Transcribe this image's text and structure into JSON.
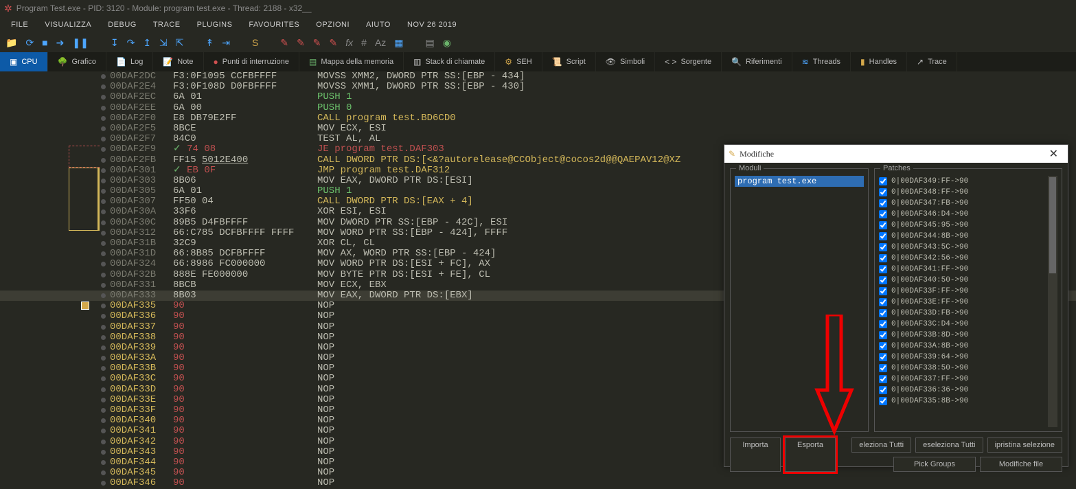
{
  "title": "Program Test.exe - PID: 3120 - Module: program test.exe - Thread: 2188 - x32__",
  "menu": [
    "FILE",
    "VISUALIZZA",
    "DEBUG",
    "TRACE",
    "PLUGINS",
    "FAVOURITES",
    "OPZIONI",
    "AIUTO",
    "NOV 26 2019"
  ],
  "tabs": [
    {
      "label": "CPU",
      "icon": "▣",
      "active": true,
      "color": "#5bb"
    },
    {
      "label": "Grafico",
      "icon": "🌳"
    },
    {
      "label": "Log",
      "icon": "📄"
    },
    {
      "label": "Note",
      "icon": "📝"
    },
    {
      "label": "Punti di interruzione",
      "icon": "●",
      "iconColor": "#d05050"
    },
    {
      "label": "Mappa della memoria",
      "icon": "▤",
      "iconColor": "#6bb36b"
    },
    {
      "label": "Stack di chiamate",
      "icon": "▥"
    },
    {
      "label": "SEH",
      "icon": "⚙",
      "iconColor": "#d4a84b"
    },
    {
      "label": "Script",
      "icon": "📜"
    },
    {
      "label": "Simboli",
      "icon": "👁"
    },
    {
      "label": "Sorgente",
      "icon": "< >"
    },
    {
      "label": "Riferimenti",
      "icon": "🔍"
    },
    {
      "label": "Threads",
      "icon": "≋",
      "iconColor": "#4da6ff"
    },
    {
      "label": "Handles",
      "icon": "▮",
      "iconColor": "#d4a84b"
    },
    {
      "label": "Trace",
      "icon": "↗"
    }
  ],
  "rows": [
    {
      "addr": "00DAF2DC",
      "bytes": "F3:0F1095 CCFBFFFF",
      "instr": "MOVSS XMM2, DWORD PTR SS:[EBP - 434]"
    },
    {
      "addr": "00DAF2E4",
      "bytes": "F3:0F108D D0FBFFFF",
      "instr": "MOVSS XMM1, DWORD PTR SS:[EBP - 430]"
    },
    {
      "addr": "00DAF2EC",
      "bytes": "6A 01",
      "instr": "PUSH 1",
      "istyle": "green"
    },
    {
      "addr": "00DAF2EE",
      "bytes": "6A 00",
      "instr": "PUSH 0",
      "istyle": "green"
    },
    {
      "addr": "00DAF2F0",
      "bytes": "E8 DB79E2FF",
      "instr": "CALL program test.BD6CD0",
      "istyle": "yellow"
    },
    {
      "addr": "00DAF2F5",
      "bytes": "8BCE",
      "instr": "MOV ECX, ESI"
    },
    {
      "addr": "00DAF2F7",
      "bytes": "84C0",
      "instr": "TEST AL, AL"
    },
    {
      "addr": "00DAF2F9",
      "bytes": "74 08",
      "bstyle": "red",
      "bprefix": "✓ ",
      "instr": "JE program test.DAF303",
      "istyle": "red"
    },
    {
      "addr": "00DAF2FB",
      "bytes": "FF15 ",
      "btail": "5012E400",
      "btailul": true,
      "instr": "CALL DWORD PTR DS:[<&?autorelease@CCObject@cocos2d@@QAEPAV12@XZ",
      "istyle": "yellow"
    },
    {
      "addr": "00DAF301",
      "bytes": "EB 0F",
      "bstyle": "red",
      "bprefix": "✓ ",
      "instr": "JMP program test.DAF312",
      "istyle": "yellow"
    },
    {
      "addr": "00DAF303",
      "bytes": "8B06",
      "instr": "MOV EAX, DWORD PTR DS:[ESI]"
    },
    {
      "addr": "00DAF305",
      "bytes": "6A 01",
      "instr": "PUSH 1",
      "istyle": "green"
    },
    {
      "addr": "00DAF307",
      "bytes": "FF50 04",
      "instr": "CALL DWORD PTR DS:[EAX + 4]",
      "istyle": "yellow"
    },
    {
      "addr": "00DAF30A",
      "bytes": "33F6",
      "instr": "XOR ESI, ESI"
    },
    {
      "addr": "00DAF30C",
      "bytes": "89B5 D4FBFFFF",
      "instr": "MOV DWORD PTR SS:[EBP - 42C], ESI"
    },
    {
      "addr": "00DAF312",
      "bytes": "66:C785 DCFBFFFF FFFF",
      "instr": "MOV WORD PTR SS:[EBP - 424], FFFF"
    },
    {
      "addr": "00DAF31B",
      "bytes": "32C9",
      "instr": "XOR CL, CL"
    },
    {
      "addr": "00DAF31D",
      "bytes": "66:8B85 DCFBFFFF",
      "instr": "MOV AX, WORD PTR SS:[EBP - 424]"
    },
    {
      "addr": "00DAF324",
      "bytes": "66:8986 FC000000",
      "instr": "MOV WORD PTR DS:[ESI + FC], AX"
    },
    {
      "addr": "00DAF32B",
      "bytes": "888E FE000000",
      "instr": "MOV BYTE PTR DS:[ESI + FE], CL"
    },
    {
      "addr": "00DAF331",
      "bytes": "8BCB",
      "instr": "MOV ECX, EBX"
    },
    {
      "addr": "00DAF333",
      "bytes": "8B03",
      "instr": "MOV EAX, DWORD PTR DS:[EBX]",
      "sel": true
    },
    {
      "addr": "00DAF335",
      "bytes": "90",
      "bstyle": "red",
      "instr": "NOP",
      "ayellow": true,
      "bm": true
    },
    {
      "addr": "00DAF336",
      "bytes": "90",
      "bstyle": "red",
      "instr": "NOP",
      "ayellow": true
    },
    {
      "addr": "00DAF337",
      "bytes": "90",
      "bstyle": "red",
      "instr": "NOP",
      "ayellow": true
    },
    {
      "addr": "00DAF338",
      "bytes": "90",
      "bstyle": "red",
      "instr": "NOP",
      "ayellow": true
    },
    {
      "addr": "00DAF339",
      "bytes": "90",
      "bstyle": "red",
      "instr": "NOP",
      "ayellow": true
    },
    {
      "addr": "00DAF33A",
      "bytes": "90",
      "bstyle": "red",
      "instr": "NOP",
      "ayellow": true
    },
    {
      "addr": "00DAF33B",
      "bytes": "90",
      "bstyle": "red",
      "instr": "NOP",
      "ayellow": true
    },
    {
      "addr": "00DAF33C",
      "bytes": "90",
      "bstyle": "red",
      "instr": "NOP",
      "ayellow": true
    },
    {
      "addr": "00DAF33D",
      "bytes": "90",
      "bstyle": "red",
      "instr": "NOP",
      "ayellow": true
    },
    {
      "addr": "00DAF33E",
      "bytes": "90",
      "bstyle": "red",
      "instr": "NOP",
      "ayellow": true
    },
    {
      "addr": "00DAF33F",
      "bytes": "90",
      "bstyle": "red",
      "instr": "NOP",
      "ayellow": true
    },
    {
      "addr": "00DAF340",
      "bytes": "90",
      "bstyle": "red",
      "instr": "NOP",
      "ayellow": true
    },
    {
      "addr": "00DAF341",
      "bytes": "90",
      "bstyle": "red",
      "instr": "NOP",
      "ayellow": true
    },
    {
      "addr": "00DAF342",
      "bytes": "90",
      "bstyle": "red",
      "instr": "NOP",
      "ayellow": true
    },
    {
      "addr": "00DAF343",
      "bytes": "90",
      "bstyle": "red",
      "instr": "NOP",
      "ayellow": true
    },
    {
      "addr": "00DAF344",
      "bytes": "90",
      "bstyle": "red",
      "instr": "NOP",
      "ayellow": true
    },
    {
      "addr": "00DAF345",
      "bytes": "90",
      "bstyle": "red",
      "instr": "NOP",
      "ayellow": true
    },
    {
      "addr": "00DAF346",
      "bytes": "90",
      "bstyle": "red",
      "instr": "NOP",
      "ayellow": true
    }
  ],
  "dialog": {
    "title": "Modifiche",
    "moduli_label": "Moduli",
    "patches_label": "Patches",
    "module": "program test.exe",
    "patches": [
      "0|00DAF335:8B->90",
      "0|00DAF336:36->90",
      "0|00DAF337:FF->90",
      "0|00DAF338:50->90",
      "0|00DAF339:64->90",
      "0|00DAF33A:8B->90",
      "0|00DAF33B:8D->90",
      "0|00DAF33C:D4->90",
      "0|00DAF33D:FB->90",
      "0|00DAF33E:FF->90",
      "0|00DAF33F:FF->90",
      "0|00DAF340:50->90",
      "0|00DAF341:FF->90",
      "0|00DAF342:56->90",
      "0|00DAF343:5C->90",
      "0|00DAF344:8B->90",
      "0|00DAF345:95->90",
      "0|00DAF346:D4->90",
      "0|00DAF347:FB->90",
      "0|00DAF348:FF->90",
      "0|00DAF349:FF->90"
    ],
    "btn_importa": "Importa",
    "btn_esporta": "Esporta",
    "btn_sel_all": "eleziona Tutti",
    "btn_desel_all": "eseleziona Tutti",
    "btn_restore": "ipristina selezione",
    "btn_pick": "Pick Groups",
    "btn_patchfile": "Modifiche file"
  }
}
